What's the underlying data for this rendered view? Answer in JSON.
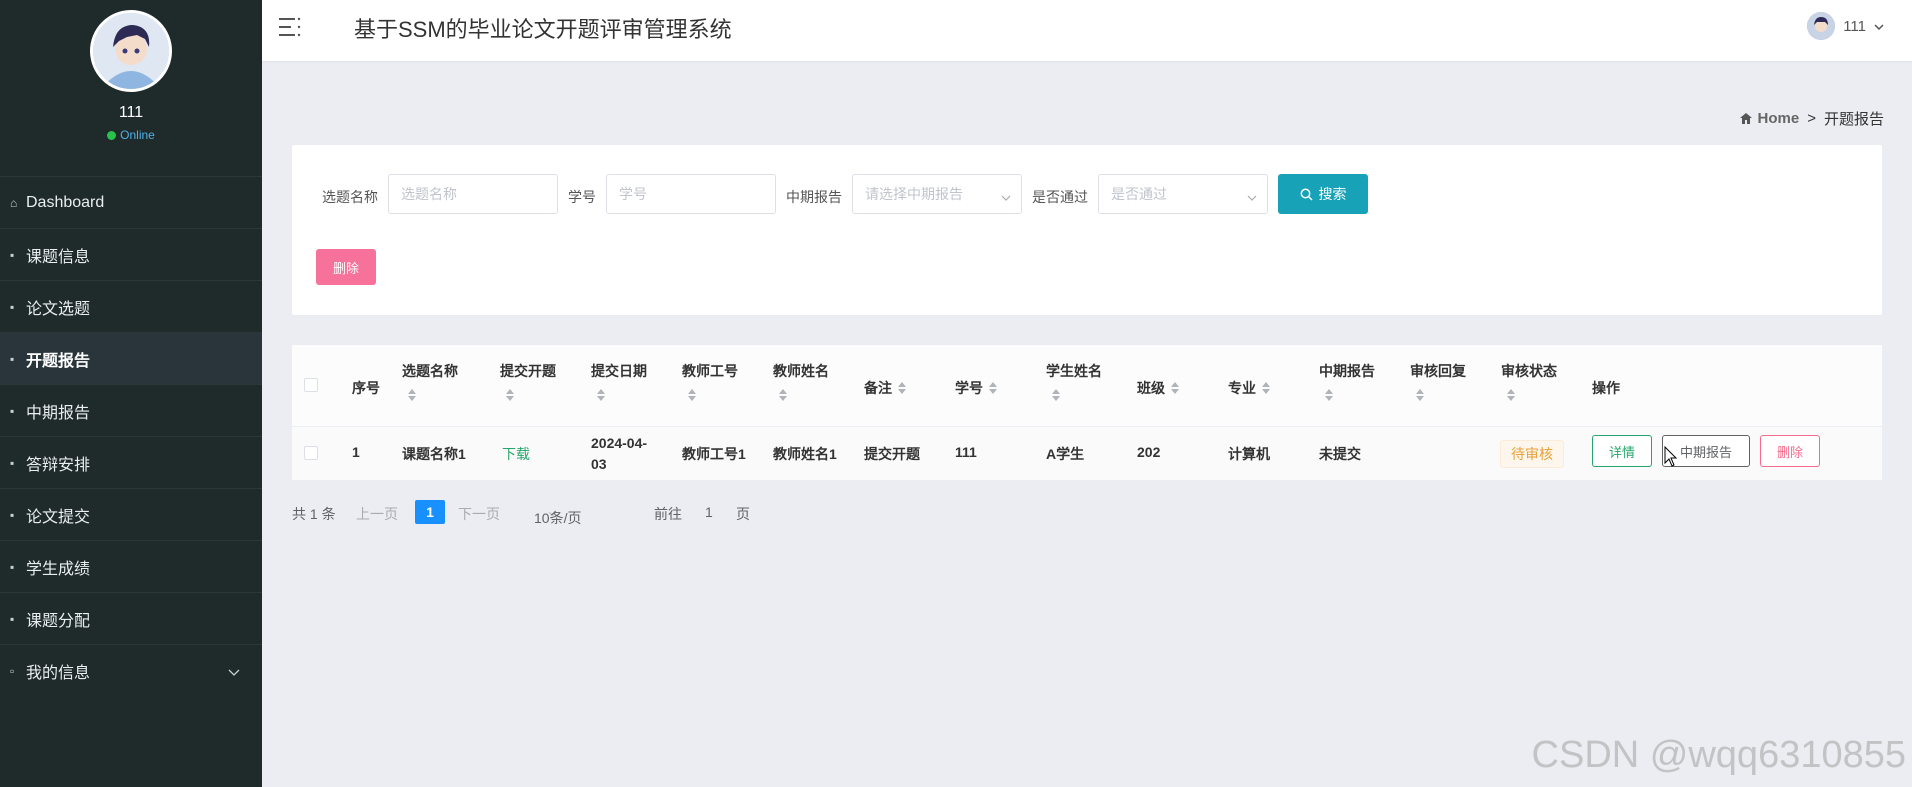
{
  "app": {
    "title": "基于SSM的毕业论文开题评审管理系统"
  },
  "user": {
    "name": "111",
    "status": "Online"
  },
  "sidebar": {
    "items": [
      {
        "label": "Dashboard"
      },
      {
        "label": "课题信息"
      },
      {
        "label": "论文选题"
      },
      {
        "label": "开题报告",
        "active": true
      },
      {
        "label": "中期报告"
      },
      {
        "label": "答辩安排"
      },
      {
        "label": "论文提交"
      },
      {
        "label": "学生成绩"
      },
      {
        "label": "课题分配"
      },
      {
        "label": "我的信息"
      }
    ]
  },
  "breadcrumb": {
    "home": "Home",
    "separator": ">",
    "current": "开题报告"
  },
  "search": {
    "topic_label": "选题名称",
    "topic_placeholder": "选题名称",
    "student_no_label": "学号",
    "student_no_placeholder": "学号",
    "mid_report_label": "中期报告",
    "mid_report_placeholder": "请选择中期报告",
    "passed_label": "是否通过",
    "passed_placeholder": "是否通过",
    "search_button": "搜索",
    "delete_button": "删除"
  },
  "table": {
    "columns": [
      "序号",
      "选题名称",
      "提交开题",
      "提交日期",
      "教师工号",
      "教师姓名",
      "备注",
      "学号",
      "学生姓名",
      "班级",
      "专业",
      "中期报告",
      "审核回复",
      "审核状态",
      "操作"
    ],
    "rows": [
      {
        "index": "1",
        "topic": "课题名称1",
        "submit": "下载",
        "date_line1": "2024-04-",
        "date_line2": "03",
        "teacher_no": "教师工号1",
        "teacher_name": "教师姓名1",
        "remark": "提交开题",
        "student_no": "111",
        "student_name": "A学生",
        "class": "202",
        "major": "计算机",
        "mid_report": "未提交",
        "review_reply": "",
        "review_status": "待审核",
        "actions": {
          "detail": "详情",
          "mid": "中期报告",
          "delete": "删除"
        }
      }
    ]
  },
  "pagination": {
    "total": "共 1 条",
    "prev": "上一页",
    "current": "1",
    "next": "下一页",
    "page_size": "10条/页",
    "goto_prefix": "前往",
    "goto_value": "1",
    "goto_suffix": "页"
  },
  "watermark": "CSDN @wqq6310855",
  "colors": {
    "sidebar_bg": "#1f2a2a",
    "primary": "#17a2b8",
    "danger": "#f7729a",
    "page_active": "#1890ff",
    "success": "#25a66c"
  }
}
